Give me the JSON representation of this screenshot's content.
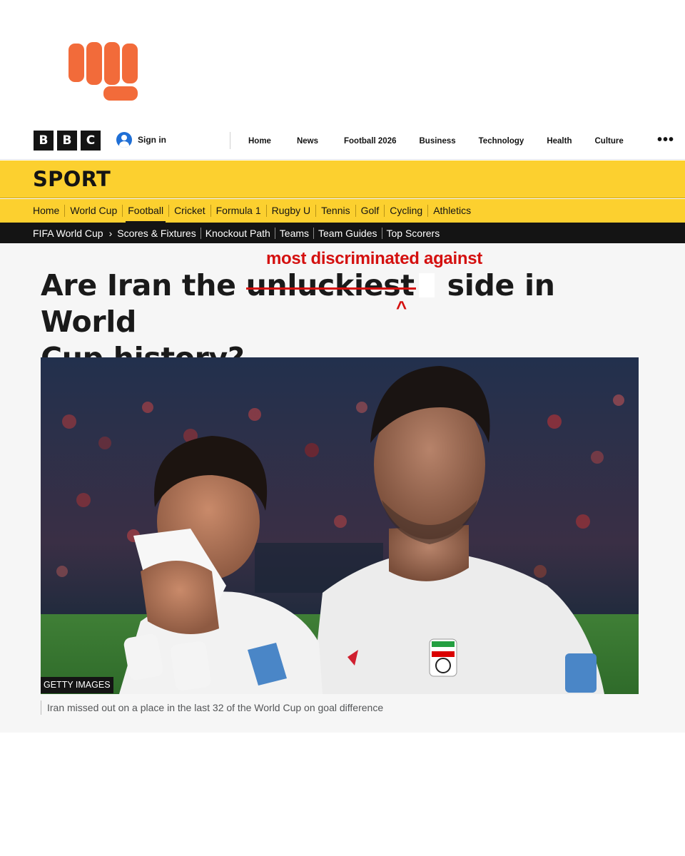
{
  "brand": {
    "logo_icon": "fist-logo-icon",
    "logo_color": "#f26b3a"
  },
  "global_header": {
    "bbc_letters": [
      "B",
      "B",
      "C"
    ],
    "sign_in": "Sign in",
    "nav": [
      "Home",
      "News",
      "Football 2026",
      "Business",
      "Technology",
      "Health",
      "Culture"
    ],
    "more_icon": "more-dots-icon"
  },
  "sport": {
    "title": "SPORT",
    "nav": [
      "Home",
      "World Cup",
      "Football",
      "Cricket",
      "Formula 1",
      "Rugby U",
      "Tennis",
      "Golf",
      "Cycling",
      "Athletics"
    ],
    "active_nav": "Football",
    "accent_color": "#fcd02f"
  },
  "sub_nav": {
    "section": "FIFA World Cup",
    "items": [
      "Scores & Fixtures",
      "Knockout Path",
      "Teams",
      "Team Guides",
      "Top Scorers"
    ]
  },
  "article": {
    "headline_start": "Are Iran the ",
    "headline_struck": "unluckiest",
    "headline_end_line1": " side in World",
    "headline_line2": "Cup history?",
    "annotation": "most discriminated against",
    "annotation_caret": "^",
    "annotation_color": "#d4100f",
    "image_credit": "GETTY IMAGES",
    "caption": "Iran missed out on a place in the last 32 of the World Cup on goal difference"
  }
}
